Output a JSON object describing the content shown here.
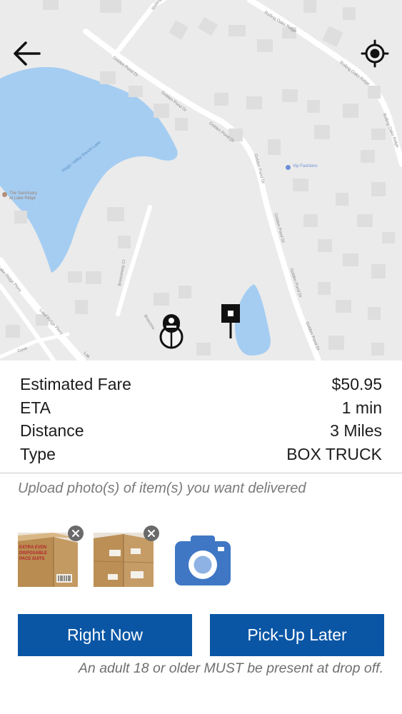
{
  "map": {
    "street_labels": {
      "golden_pond_1": "Golden Pond Dr",
      "golden_pond_2": "Golden Pond Dr",
      "golden_pond_3": "Golden Pond Dr",
      "golden_pond_4": "Golden Pond Dr",
      "golden_pond_5": "Golden Pond Dr",
      "golden_pond_6": "Golden Pond Dr",
      "golden_pond_7": "Golden Pond Dr",
      "rolling_oaks_1": "Rolling Oaks Ridge",
      "rolling_oaks_2": "Rolling Oaks Ridge",
      "rolling_oaks_3": "Rolling Oaks Ridge",
      "lake_name": "Magic Valley Ranch Lake",
      "breezeway": "Breezeway Ct",
      "breezeway_2": "Breezew",
      "lake_ridge_1": "Lake Ridge Pkwy",
      "lake_ridge_2": "Lake Ridge Pkwy",
      "cove": "Cove",
      "lake_short": "Lak",
      "rolling_top": "Rolling O"
    },
    "pois": {
      "vip_fashions": "Vip Fashions",
      "sanctuary_line1": "The Sanctuary",
      "sanctuary_line2": "at Lake Ridge"
    },
    "icons": {
      "back": "arrow-left-icon",
      "locate": "my-location-icon",
      "pickup": "pickup-pin-icon",
      "dropoff": "dropoff-pin-icon"
    }
  },
  "fare": {
    "rows": [
      {
        "label": "Estimated Fare",
        "value": "$50.95"
      },
      {
        "label": "ETA",
        "value": "1 min"
      },
      {
        "label": "Distance",
        "value": "3 Miles"
      },
      {
        "label": "Type",
        "value": "BOX TRUCK"
      }
    ]
  },
  "upload": {
    "hint": "Upload photo(s) of item(s) you want delivered",
    "box_print_1": "EXTRA EVEN",
    "box_print_2": "DISPOSABLE",
    "box_print_3": "PACE SUITS"
  },
  "actions": {
    "right_now": "Right Now",
    "pickup_later": "Pick-Up Later"
  },
  "disclaimer": "An adult 18 or older MUST be present at drop off.",
  "colors": {
    "button_blue": "#0a56a5",
    "camera_blue": "#3f77c4",
    "water": "#a5cdf2",
    "map_bg": "#ebebeb"
  }
}
